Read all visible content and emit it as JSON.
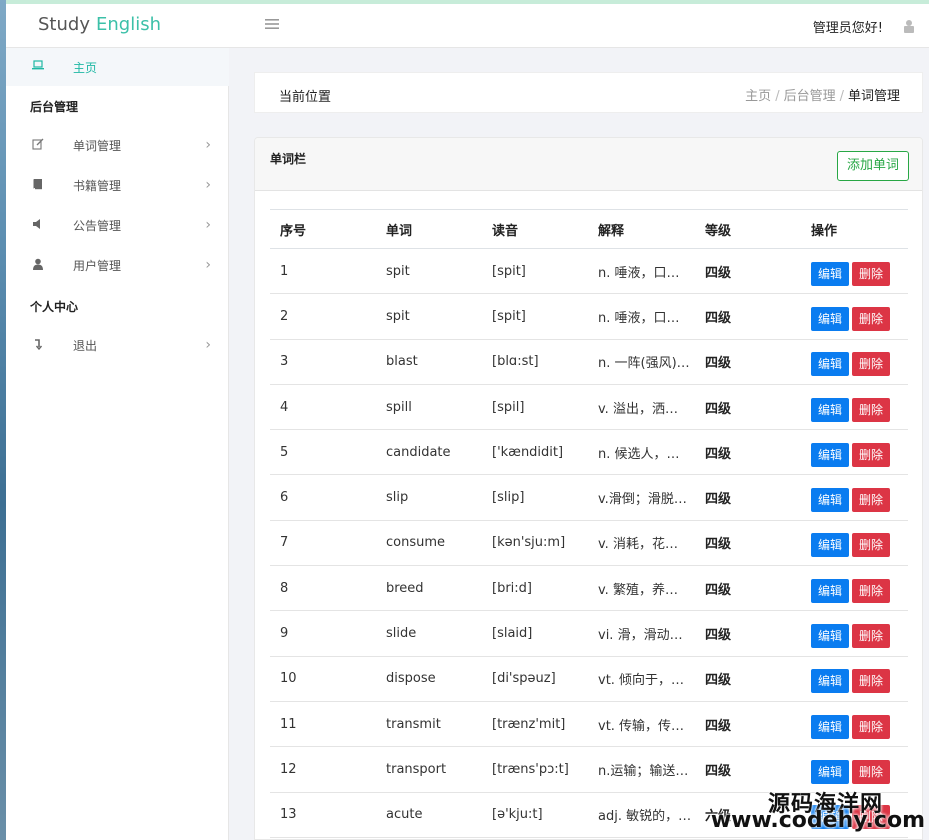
{
  "header": {
    "logo_word1": "Study",
    "logo_word2": "English",
    "menu_icon": "hamburger-icon",
    "admin_greeting": "管理员您好!",
    "admin_icon": "lock-user-icon"
  },
  "sidebar": {
    "home": {
      "label": "主页",
      "icon": "laptop-icon"
    },
    "group_admin": "后台管理",
    "items": [
      {
        "label": "单词管理",
        "icon": "edit-icon"
      },
      {
        "label": "书籍管理",
        "icon": "book-icon"
      },
      {
        "label": "公告管理",
        "icon": "speaker-icon"
      },
      {
        "label": "用户管理",
        "icon": "user-icon"
      }
    ],
    "group_personal": "个人中心",
    "logout": {
      "label": "退出",
      "icon": "logout-icon"
    }
  },
  "breadcrumb": {
    "current_label": "当前位置",
    "items": [
      "主页",
      "后台管理",
      "单词管理"
    ],
    "separator": "/"
  },
  "card": {
    "title": "单词栏",
    "add_button": "添加单词"
  },
  "table": {
    "headers": [
      "序号",
      "单词",
      "读音",
      "解释",
      "等级",
      "操作"
    ],
    "edit_label": "编辑",
    "delete_label": "删除",
    "rows": [
      {
        "id": "1",
        "word": "spit",
        "phonetic": "[spit]",
        "meaning": "n. 唾液，口…",
        "level": "四级"
      },
      {
        "id": "2",
        "word": "spit",
        "phonetic": "[spit]",
        "meaning": "n. 唾液，口…",
        "level": "四级"
      },
      {
        "id": "3",
        "word": "blast",
        "phonetic": "[blɑ:st]",
        "meaning": "n. 一阵(强风)…",
        "level": "四级"
      },
      {
        "id": "4",
        "word": "spill",
        "phonetic": "[spil]",
        "meaning": "v. 溢出，洒…",
        "level": "四级"
      },
      {
        "id": "5",
        "word": "candidate",
        "phonetic": "['kændidit]",
        "meaning": "n. 候选人，…",
        "level": "四级"
      },
      {
        "id": "6",
        "word": "slip",
        "phonetic": "[slip]",
        "meaning": "v.滑倒；滑脱…",
        "level": "四级"
      },
      {
        "id": "7",
        "word": "consume",
        "phonetic": "[kən'sju:m]",
        "meaning": "v. 消耗，花…",
        "level": "四级"
      },
      {
        "id": "8",
        "word": "breed",
        "phonetic": "[bri:d]",
        "meaning": "v. 繁殖，养…",
        "level": "四级"
      },
      {
        "id": "9",
        "word": "slide",
        "phonetic": "[slaid]",
        "meaning": "vi. 滑，滑动…",
        "level": "四级"
      },
      {
        "id": "10",
        "word": "dispose",
        "phonetic": "[di'spəuz]",
        "meaning": "vt. 倾向于，…",
        "level": "四级"
      },
      {
        "id": "11",
        "word": "transmit",
        "phonetic": "[trænz'mit]",
        "meaning": "vt. 传输，传…",
        "level": "四级"
      },
      {
        "id": "12",
        "word": "transport",
        "phonetic": "[træns'pɔ:t]",
        "meaning": "n.运输；输送…",
        "level": "四级"
      },
      {
        "id": "13",
        "word": "acute",
        "phonetic": "[ə'kju:t]",
        "meaning": "adj. 敏锐的，…",
        "level": "六级"
      }
    ]
  },
  "watermark": {
    "line1": "源码海洋网",
    "line2": "www.codehy.com"
  }
}
